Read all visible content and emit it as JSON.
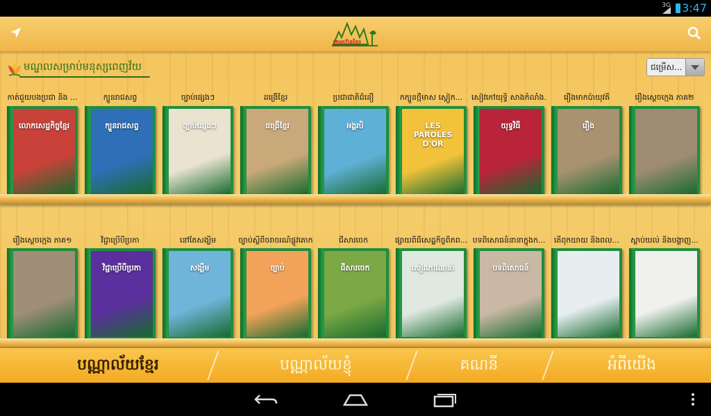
{
  "status_bar": {
    "network": "3G",
    "time": "3:47"
  },
  "app": {
    "logo_text": "ក្រុមហ៊ុនខ្មែរ"
  },
  "section": {
    "title": "មណ្ឌលសម្រាប់មនុស្សពេញវ័យ"
  },
  "sort_dropdown": {
    "selected": "ជម្រើស..."
  },
  "shelves": [
    {
      "books": [
        {
          "title": "កាត់ជួយបងប្រជា និង ...",
          "cover_text": "លោកសេដ្ឋកិច្ចខ្មែរ",
          "cover_color": "#c9423a"
        },
        {
          "title": "ក្បួនរាជសព្វ",
          "cover_text": "ក្បួនរាជសព្វ",
          "cover_color": "#2f6fb7"
        },
        {
          "title": "ច្បាប់ផ្សេងៗ",
          "cover_text": "ច្បាប់ផ្សេងៗ",
          "cover_color": "#e9e3d0"
        },
        {
          "title": "ដង្រើខ្មែរ",
          "cover_text": "ដង្រើខ្មែរ",
          "cover_color": "#c9a97a"
        },
        {
          "title": "ប្រជាជាតិជំនឿ",
          "cover_text": "អង្គរបិ",
          "cover_color": "#5fb0d6"
        },
        {
          "title": "កក្បួនថ្មីមាស ស្ដៀក...",
          "cover_text": "LES PAROLES D'OR",
          "cover_color": "#f2c23b"
        },
        {
          "title": "សៀវភៅយុទ្ធិ សាងកំលាំង...",
          "cover_text": "យុទ្ធវិធី",
          "cover_color": "#b9243a"
        },
        {
          "title": "រឿងមាកប៉ាយុវតី",
          "cover_text": "រឿង",
          "cover_color": "#a89270"
        },
        {
          "title": "រឿងស្តេចក្មេង ភាគ២",
          "cover_text": "",
          "cover_color": "#9e8c72"
        }
      ]
    },
    {
      "books": [
        {
          "title": "រឿងស្តេចក្មេង ភាគ១",
          "cover_text": "",
          "cover_color": "#9f8e78"
        },
        {
          "title": "វិជ្ជាប្រើបីប្រភា",
          "cover_text": "វិជ្ជាប្រើបីប្រភា",
          "cover_color": "#5b2f9e"
        },
        {
          "title": "នៅតែសង្ឃឹម",
          "cover_text": "សង្ឃឹម",
          "cover_color": "#6fb4d9"
        },
        {
          "title": "ច្បាប់ស្ដីពីចរាចរណ៍ផ្លូវគោក",
          "cover_text": "ច្បាប់",
          "cover_color": "#f4a35a"
        },
        {
          "title": "ជីសារចេក",
          "cover_text": "ជីសារចេក",
          "cover_color": "#7ca845"
        },
        {
          "title": "ផ្សាយពិធីសេដ្ឋកិច្ចពិភព...",
          "cover_text": "សៀវភៅណែនាំ",
          "cover_color": "#dfe9e0"
        },
        {
          "title": "បទពិសោធន៍នានាក្នុងក...",
          "cover_text": "បទពិសោធន៍",
          "cover_color": "#c9b8a4"
        },
        {
          "title": "តើពុកយាយ និងពល...",
          "cover_text": "",
          "cover_color": "#e8eef0"
        },
        {
          "title": "ស្ដាប់យល់ និងបង្ហាញ...",
          "cover_text": "",
          "cover_color": "#f0f0ee"
        }
      ]
    }
  ],
  "tabs": [
    {
      "label": "បណ្ណាល័យខ្មែរ",
      "active": true
    },
    {
      "label": "បណ្ណាល័យខ្ញុំ",
      "active": false
    },
    {
      "label": "គណនី",
      "active": false
    },
    {
      "label": "អំពីយើង",
      "active": false
    }
  ],
  "system_nav": {
    "back": "back-icon",
    "home": "home-icon",
    "recents": "recents-icon"
  }
}
